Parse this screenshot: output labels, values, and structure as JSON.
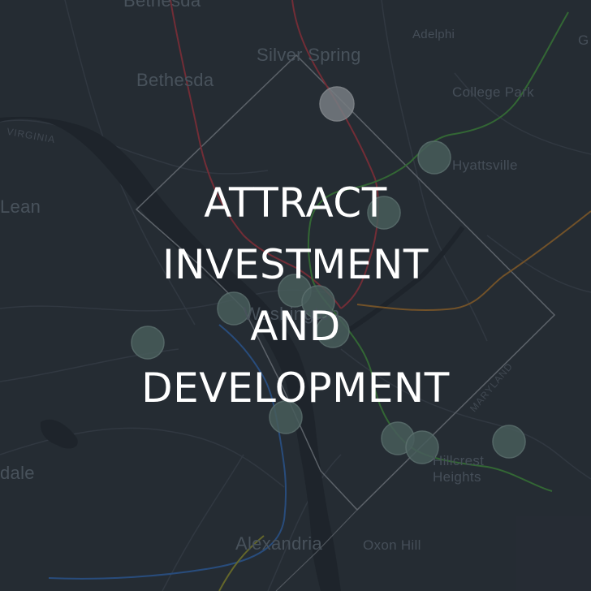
{
  "headline": {
    "line1": "ATTRACT",
    "line2": "INVESTMENT",
    "line3": "AND",
    "line4": "DEVELOPMENT"
  },
  "places": {
    "bethesda_top": "Bethesda",
    "adelphi": "Adelphi",
    "silver_spring": "Silver Spring",
    "bethesda": "Bethesda",
    "college_park": "College Park",
    "virginia": "VIRGINIA",
    "hyattsville": "Hyattsville",
    "mclean": "Lean",
    "washington": "Washington",
    "maryland": "MARYLAND",
    "hillcrest_heights_1": "Hillcrest",
    "hillcrest_heights_2": "Heights",
    "annandale": "dale",
    "alexandria": "Alexandria",
    "oxon_hill": "Oxon Hill",
    "edge_g": "G"
  },
  "colors": {
    "background": "#2a3038",
    "boundary": "#8a8f96",
    "red_line": "#a0323c",
    "green_line": "#3f8a3a",
    "blue_line": "#2f62a8",
    "orange_line": "#a06a28",
    "marker_fill": "#5f7a75",
    "marker_light": "#a7abb0"
  }
}
